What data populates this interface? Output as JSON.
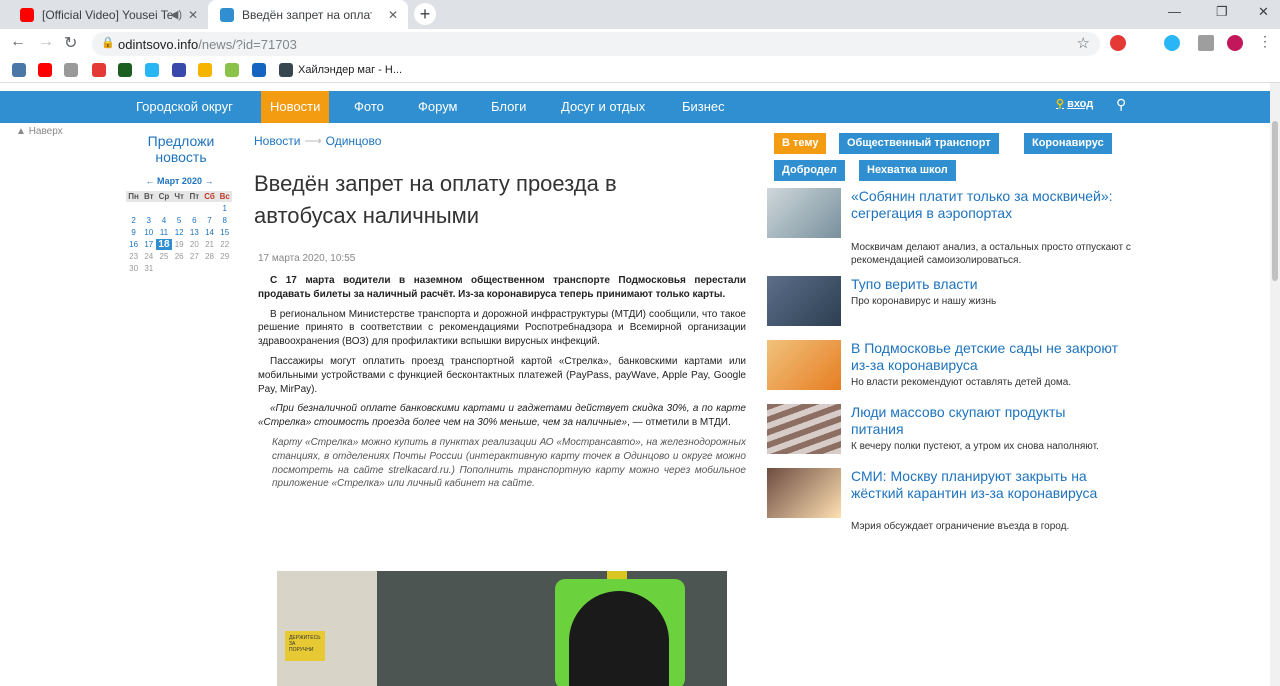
{
  "browser": {
    "tabs": [
      {
        "label": "[Official Video] Yousei Teikoku"
      },
      {
        "label": "Введён запрет на оплату проезда"
      }
    ],
    "url_host": "odintsovo.info",
    "url_path": "/news/?id=71703",
    "bookmark_label": "Хайлэндер маг - Н..."
  },
  "site_nav": {
    "items": [
      "Городской округ",
      "Новости",
      "Фото",
      "Форум",
      "Блоги",
      "Досуг и отдых",
      "Бизнес"
    ],
    "login": "вход"
  },
  "sidebar": {
    "back_to_top": "Наверх",
    "suggest_news": "Предложи новость",
    "calendar": {
      "title": "← Март 2020 →",
      "weekdays": [
        "Пн",
        "Вт",
        "Ср",
        "Чт",
        "Пт",
        "Сб",
        "Вс"
      ],
      "today": "18"
    }
  },
  "article": {
    "breadcrumb": [
      "Новости",
      "Одинцово"
    ],
    "title": "Введён запрет на оплату проезда в автобусах наличными",
    "date": "17 марта 2020, 10:55",
    "lead": "С 17 марта водители в наземном общественном транспорте Подмосковья перестали продавать билеты за наличный расчёт. Из-за коронавируса теперь принимают только карты.",
    "p1": "В региональном Министерстве транспорта и дорожной инфраструктуры (МТДИ) сообщили, что такое решение принято в соответствии с рекомендациями Роспотребнадзора и Всемирной организации здравоохранения (ВОЗ) для профилактики вспышки вирусных инфекций.",
    "p2": "Пассажиры могут оплатить проезд транспортной картой «Стрелка», банковскими картами или мобильными устройствами с функцией бесконтактных платежей (PayPass, payWave, Apple Pay, Google Pay, MirPay).",
    "quote": "«При безналичной оплате банковскими картами и гаджетами действует скидка 30%, а по карте «Стрелка» стоимость проезда более чем на 30% меньше, чем за наличные»",
    "quote_tail": ", — отметили в МТДИ.",
    "note": "Карту «Стрелка» можно купить в пунктах реализации АО «Мострансавто», на железнодорожных станциях, в отделениях Почты России (интерактивную карту точек в Одинцово и округе можно посмотреть на сайте strelkacard.ru.) Пополнить транспортную карту можно через мобильное приложение «Стрелка» или личный кабинет на сайте.",
    "photo_sign": "ДЕРЖИТЕСЬ ЗА ПОРУЧНИ"
  },
  "tags": [
    "В тему",
    "Общественный транспорт",
    "Коронавирус",
    "Добродел",
    "Нехватка школ"
  ],
  "related": [
    {
      "title": "«Собянин платит только за москвичей»: сегрегация в аэропортах",
      "sub": "Москвичам делают анализ, а остальных просто отпускают с рекомендацией самоизолироваться."
    },
    {
      "title": "Тупо верить власти",
      "sub": "Про коронавирус и нашу жизнь"
    },
    {
      "title": "В Подмосковье детские сады не закроют из-за коронавируса",
      "sub": "Но власти рекомендуют оставлять детей дома."
    },
    {
      "title": "Люди массово скупают продукты питания",
      "sub": "К вечеру полки пустеют, а утром их снова наполняют."
    },
    {
      "title": "СМИ: Москву планируют закрыть на жёсткий карантин из-за коронавируса",
      "sub": "Мэрия обсуждает ограничение въезда в город."
    }
  ],
  "colors": {
    "nav_bg": "#2f8fd0",
    "accent": "#f39c12",
    "link": "#1e73be"
  }
}
